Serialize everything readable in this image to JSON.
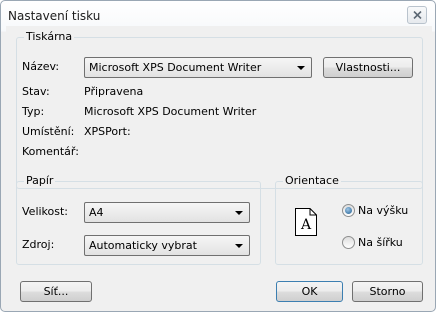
{
  "window": {
    "title": "Nastavení tisku"
  },
  "printer": {
    "group_title": "Tiskárna",
    "name_label": "Název:",
    "name_value": "Microsoft XPS Document Writer",
    "properties_button": "Vlastnosti...",
    "status_label": "Stav:",
    "status_value": "Připravena",
    "type_label": "Typ:",
    "type_value": "Microsoft XPS Document Writer",
    "location_label": "Umístění:",
    "location_value": "XPSPort:",
    "comment_label": "Komentář:",
    "comment_value": ""
  },
  "paper": {
    "group_title": "Papír",
    "size_label": "Velikost:",
    "size_value": "A4",
    "source_label": "Zdroj:",
    "source_value": "Automaticky vybrat"
  },
  "orientation": {
    "group_title": "Orientace",
    "icon_letter": "A",
    "portrait_label": "Na výšku",
    "landscape_label": "Na šířku",
    "selected": "portrait"
  },
  "buttons": {
    "network": "Síť...",
    "ok": "OK",
    "cancel": "Storno"
  },
  "icons": {
    "close": "close-icon",
    "dropdown": "chevron-down-icon",
    "orientation": "portrait-page-icon"
  }
}
